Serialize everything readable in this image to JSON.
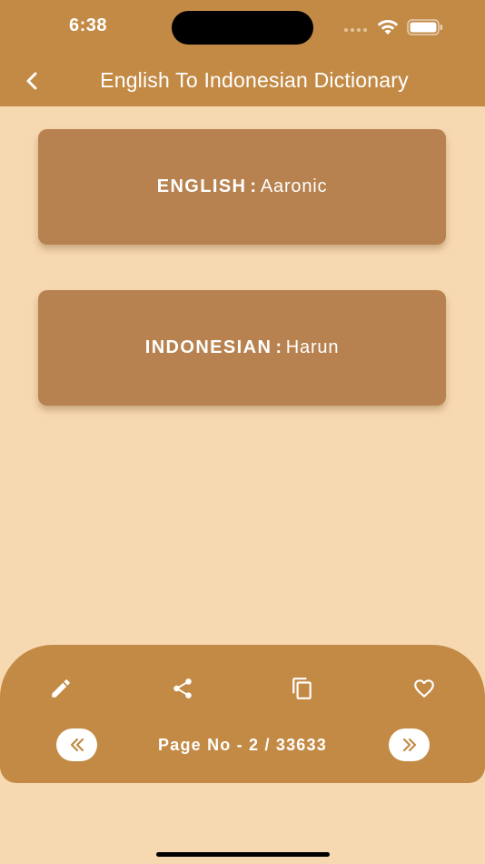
{
  "status_bar": {
    "time": "6:38"
  },
  "header": {
    "title": "English To Indonesian Dictionary",
    "back_icon": "chevron-left-icon"
  },
  "cards": {
    "english": {
      "label": "ENGLISH",
      "separator": ":",
      "value": "Aaronic"
    },
    "indonesian": {
      "label": "INDONESIAN",
      "separator": ":",
      "value": "Harun"
    }
  },
  "toolbar": {
    "actions": [
      {
        "icon": "pencil-icon"
      },
      {
        "icon": "share-icon"
      },
      {
        "icon": "copy-icon"
      },
      {
        "icon": "heart-icon"
      }
    ]
  },
  "pager": {
    "label": "Page No - 2 / 33633",
    "prev_icon": "double-chevron-left-icon",
    "next_icon": "double-chevron-right-icon"
  },
  "colors": {
    "background": "#f7d9b1",
    "header": "#c38a45",
    "card": "#b7824f",
    "text_light": "#ffffff",
    "nav_icon": "#c38a45"
  }
}
